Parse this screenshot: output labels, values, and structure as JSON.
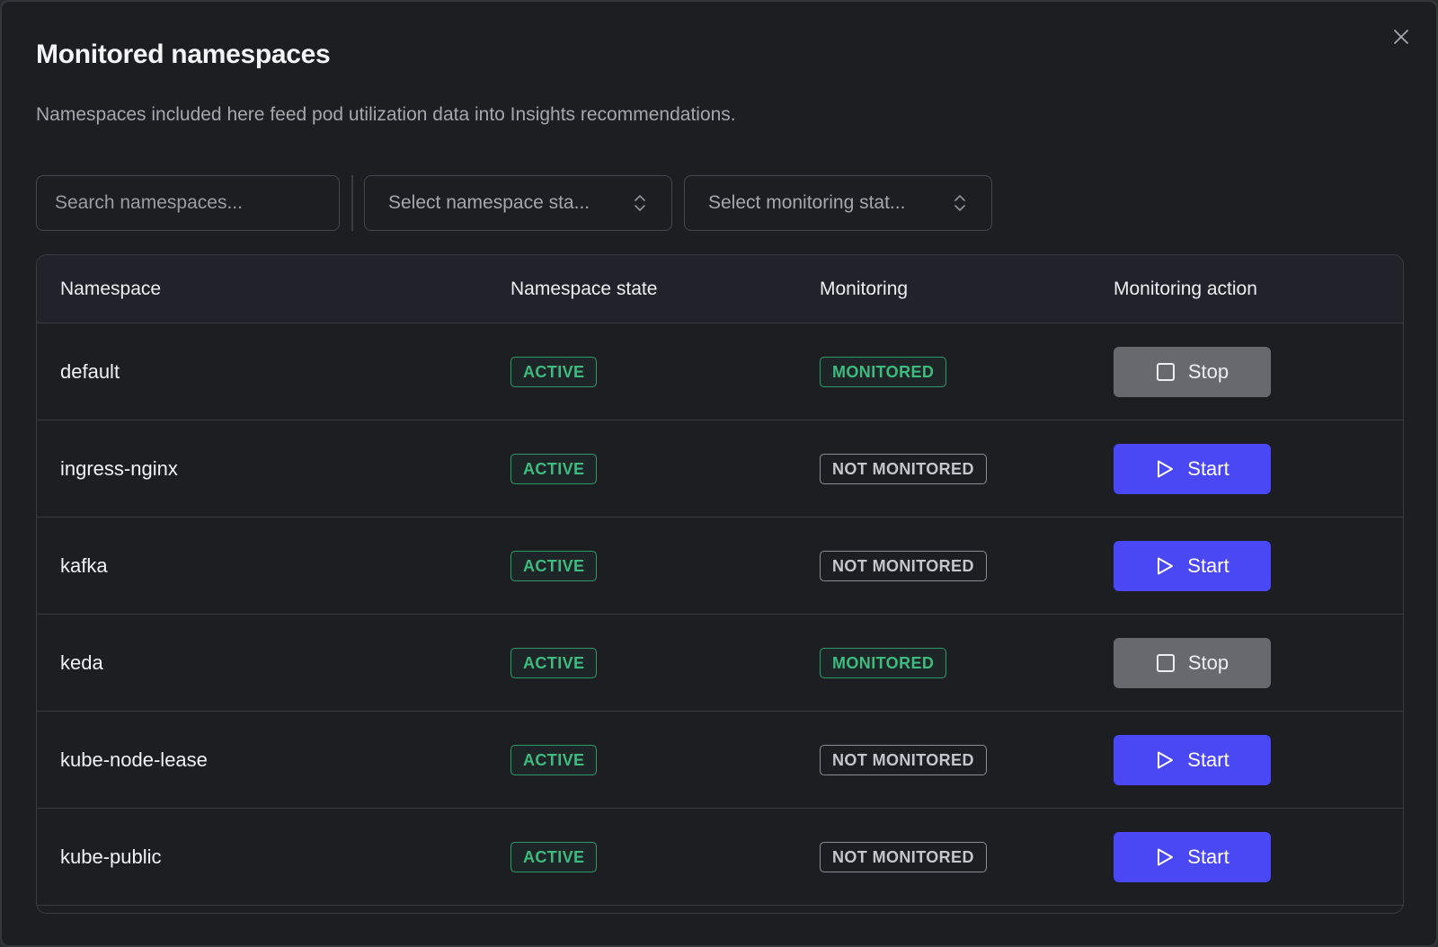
{
  "modal": {
    "title": "Monitored namespaces",
    "subtitle": "Namespaces included here feed pod utilization data into Insights recommendations.",
    "close_icon": "close-icon"
  },
  "filters": {
    "search_placeholder": "Search namespaces...",
    "namespace_state_placeholder": "Select namespace sta...",
    "monitoring_state_placeholder": "Select monitoring stat..."
  },
  "table": {
    "columns": [
      "Namespace",
      "Namespace state",
      "Monitoring",
      "Monitoring action"
    ],
    "rows": [
      {
        "namespace": "default",
        "state": "ACTIVE",
        "monitoring": "MONITORED",
        "action": "Stop"
      },
      {
        "namespace": "ingress-nginx",
        "state": "ACTIVE",
        "monitoring": "NOT MONITORED",
        "action": "Start"
      },
      {
        "namespace": "kafka",
        "state": "ACTIVE",
        "monitoring": "NOT MONITORED",
        "action": "Start"
      },
      {
        "namespace": "keda",
        "state": "ACTIVE",
        "monitoring": "MONITORED",
        "action": "Stop"
      },
      {
        "namespace": "kube-node-lease",
        "state": "ACTIVE",
        "monitoring": "NOT MONITORED",
        "action": "Start"
      },
      {
        "namespace": "kube-public",
        "state": "ACTIVE",
        "monitoring": "NOT MONITORED",
        "action": "Start"
      }
    ]
  },
  "colors": {
    "background": "#1d1e22",
    "accent": "#4a47f5",
    "success": "#3dbb80",
    "stop_button": "#67696f"
  }
}
